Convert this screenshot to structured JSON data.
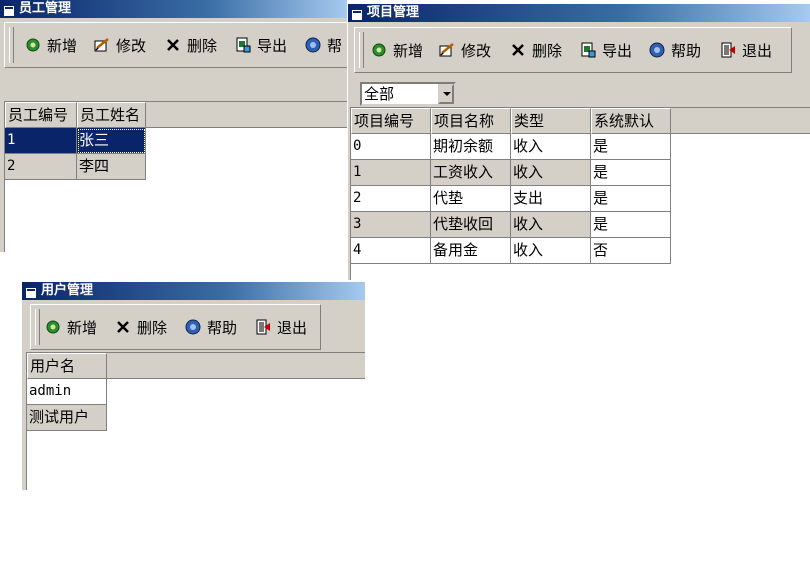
{
  "employee_window": {
    "title": "员工管理",
    "toolbar": [
      "新增",
      "修改",
      "删除",
      "导出",
      "帮"
    ],
    "columns": [
      "员工编号",
      "员工姓名"
    ],
    "rows": [
      {
        "id": "1",
        "name": "张三",
        "selected": true
      },
      {
        "id": "2",
        "name": "李四",
        "selected": false
      }
    ]
  },
  "project_window": {
    "title": "项目管理",
    "toolbar": [
      "新增",
      "修改",
      "删除",
      "导出",
      "帮助",
      "退出"
    ],
    "filter": {
      "selected": "全部"
    },
    "columns": [
      "项目编号",
      "项目名称",
      "类型",
      "系统默认"
    ],
    "rows": [
      {
        "id": "0",
        "name": "期初余额",
        "type": "收入",
        "default": "是"
      },
      {
        "id": "1",
        "name": "工资收入",
        "type": "收入",
        "default": "是"
      },
      {
        "id": "2",
        "name": "代垫",
        "type": "支出",
        "default": "是"
      },
      {
        "id": "3",
        "name": "代垫收回",
        "type": "收入",
        "default": "是"
      },
      {
        "id": "4",
        "name": "备用金",
        "type": "收入",
        "default": "否"
      }
    ]
  },
  "user_window": {
    "title": "用户管理",
    "toolbar": [
      "新增",
      "删除",
      "帮助",
      "退出"
    ],
    "columns": [
      "用户名"
    ],
    "rows": [
      "admin",
      "测试用户"
    ]
  },
  "colors": {
    "title_start": "#0a246a",
    "title_end": "#a6caf0",
    "face": "#d4d0c8",
    "selection": "#0a246a"
  },
  "icons": [
    "window-icon",
    "add-icon",
    "edit-icon",
    "delete-icon",
    "export-icon",
    "help-icon",
    "exit-icon"
  ]
}
